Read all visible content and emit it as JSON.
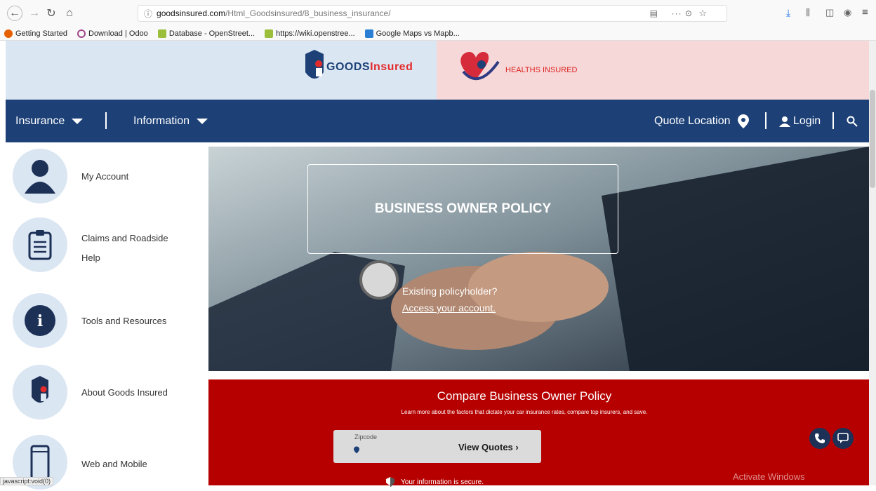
{
  "browser": {
    "url_host": "goodsinsured.com",
    "url_path": "/Html_Goodsinsured/8_business_insurance/",
    "bookmarks": [
      "Getting Started",
      "Download | Odoo",
      "Database - OpenStreet...",
      "https://wiki.openstree...",
      "Google Maps vs Mapb..."
    ],
    "status_text": "javascript:void(0)"
  },
  "banner": {
    "goods_logo_text_a": "GOODS",
    "goods_logo_text_b": "Insured",
    "healths_text": "HEALTHS INSURED"
  },
  "nav": {
    "insurance": "Insurance",
    "information": "Information",
    "quote_location": "Quote Location",
    "login": "Login"
  },
  "sidebar": {
    "items": [
      {
        "label": "My Account"
      },
      {
        "label": "Claims and Roadside Help"
      },
      {
        "label": "Tools and Resources"
      },
      {
        "label": "About Goods Insured"
      },
      {
        "label": "Web and Mobile"
      }
    ]
  },
  "hero": {
    "title": "BUSINESS OWNER POLICY",
    "existing": "Existing policyholder?",
    "access": "Access your account."
  },
  "compare": {
    "title": "Compare Business Owner Policy",
    "subtitle": "Learn more about the factors that dictate your car insurance rates, compare top insurers, and save.",
    "zip_label": "Zipcode",
    "view_quotes": "View Quotes ›",
    "secure": "Your information is secure."
  },
  "overlay": {
    "activate": "Activate Windows"
  },
  "colors": {
    "nav_blue": "#1d4177",
    "compare_red": "#b60000",
    "banner_left": "#dbe6f3",
    "banner_right": "#f6d8d8"
  }
}
